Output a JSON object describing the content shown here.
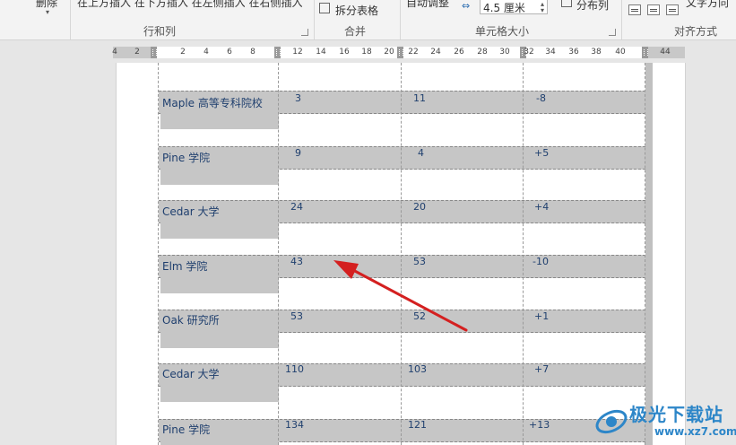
{
  "ribbon": {
    "top_texts": {
      "delete": "删除",
      "insert_row_col": "在上方插入 在下方插入 在左侧插入 在右侧插入",
      "split_table": "拆分表格",
      "auto_adjust": "自动调整",
      "height_value": "4.5 厘米",
      "distribute_columns": "分布列",
      "text_direction": "文字方向"
    },
    "groups": {
      "rows_cols": "行和列",
      "merge": "合并",
      "cell_size": "单元格大小",
      "alignment": "对齐方式"
    }
  },
  "ruler": {
    "numbers": [
      "4",
      "2",
      "2",
      "4",
      "6",
      "8",
      "12",
      "14",
      "16",
      "18",
      "20",
      "22",
      "24",
      "26",
      "28",
      "30",
      "32",
      "34",
      "36",
      "38",
      "40",
      "44"
    ]
  },
  "table": {
    "rows": [
      {
        "name": "Maple 高等专科院校",
        "a": "3",
        "b": "11",
        "c": "-8"
      },
      {
        "name": "Pine 学院",
        "a": "9",
        "b": "4",
        "c": "+5"
      },
      {
        "name": "Cedar 大学",
        "a": "24",
        "b": "20",
        "c": "+4"
      },
      {
        "name": "Elm 学院",
        "a": "43",
        "b": "53",
        "c": "-10"
      },
      {
        "name": "Oak 研究所",
        "a": "53",
        "b": "52",
        "c": "+1"
      },
      {
        "name": "Cedar 大学",
        "a": "110",
        "b": "103",
        "c": "+7"
      },
      {
        "name": "Pine 学院",
        "a": "134",
        "b": "121",
        "c": "+13"
      }
    ]
  },
  "annotation": {
    "arrow_color": "#d42020"
  },
  "watermark": {
    "title": "极光下载站",
    "url": "www.xz7.com",
    "color": "#2d86c8"
  }
}
